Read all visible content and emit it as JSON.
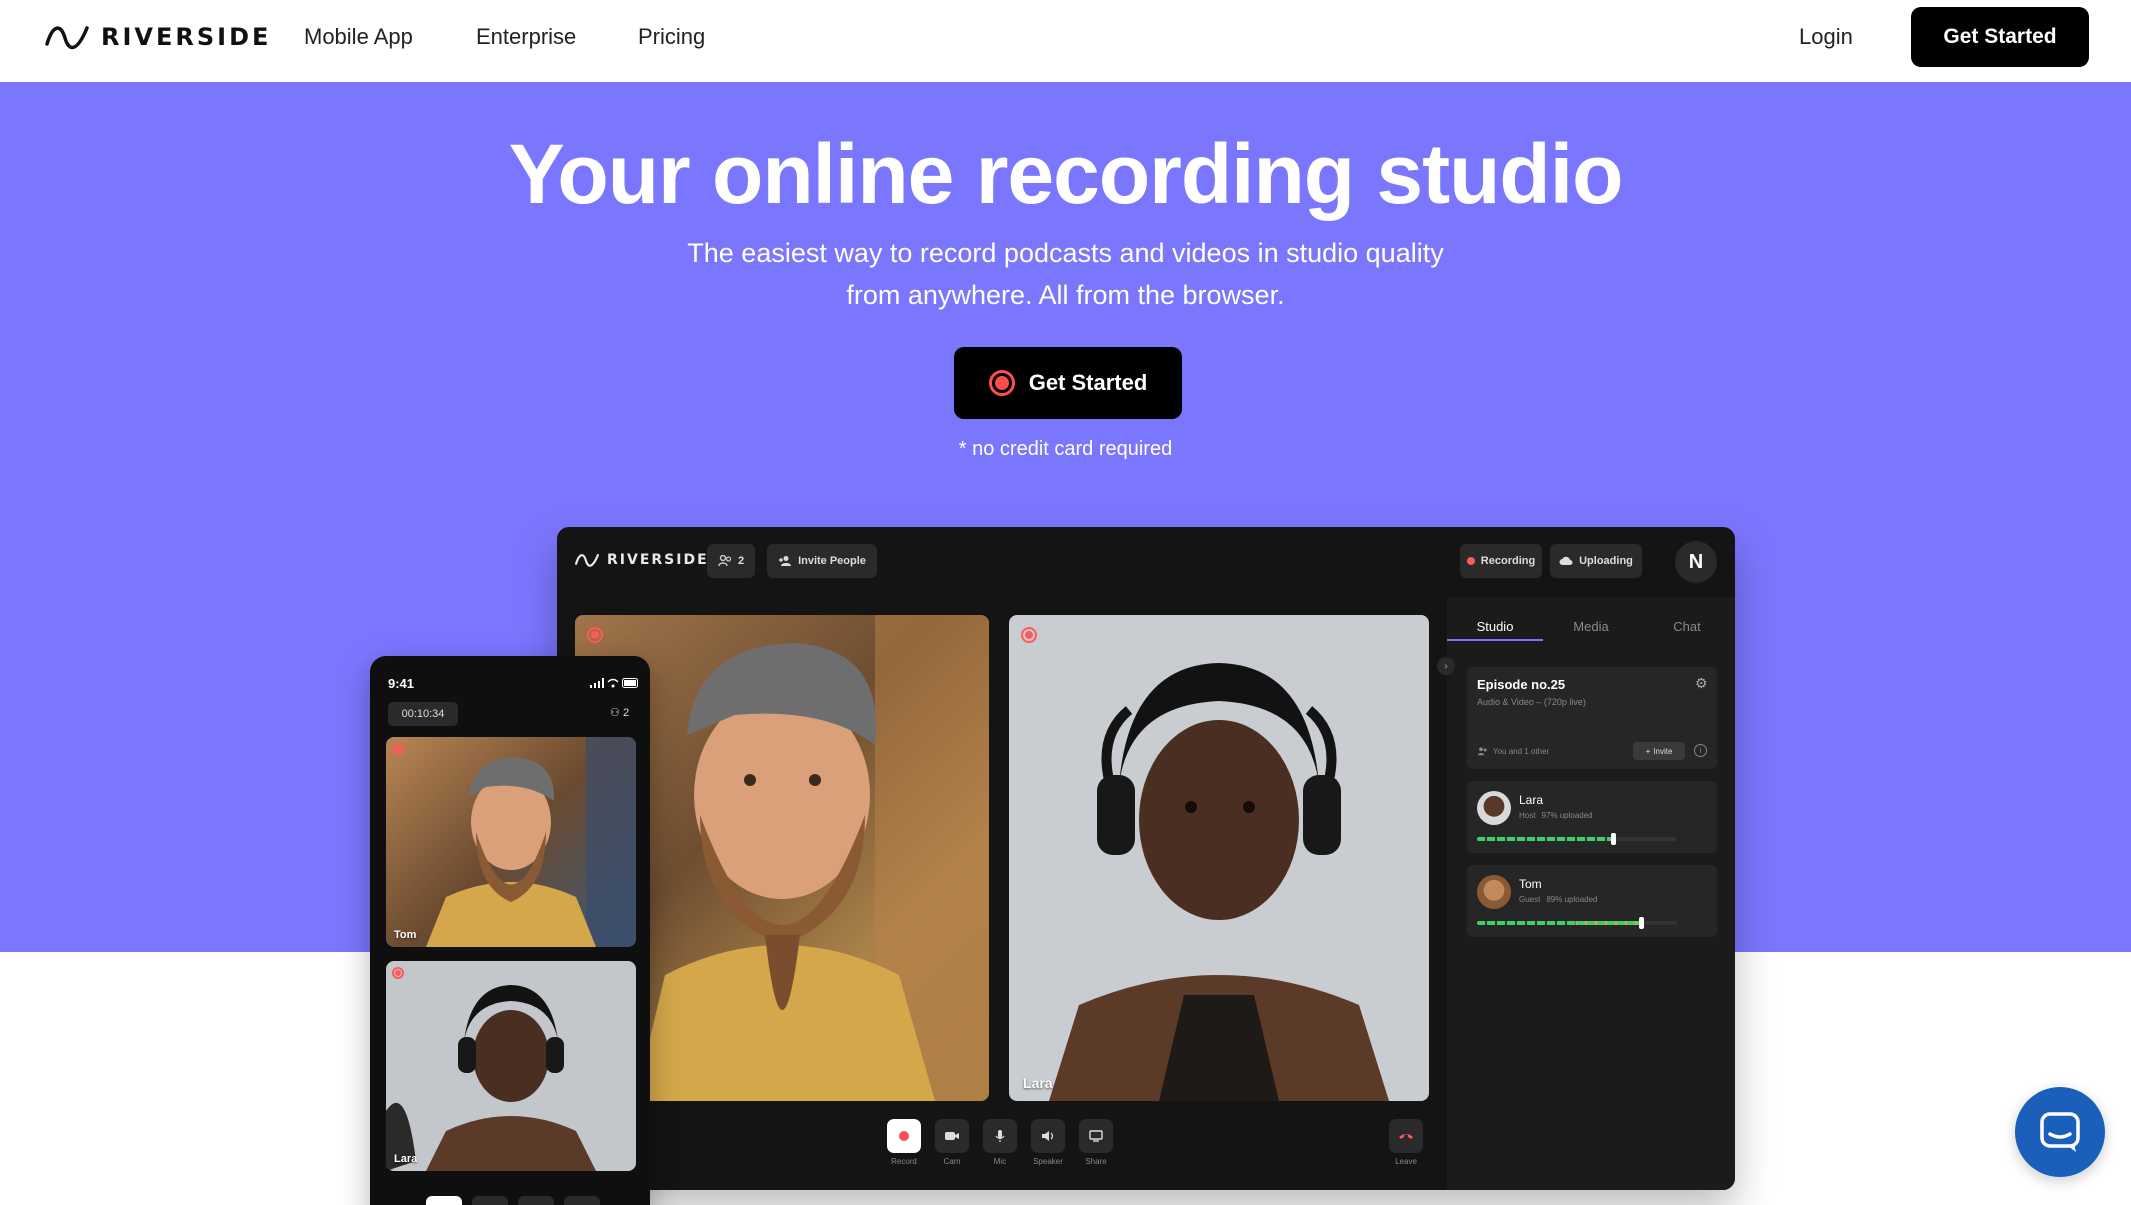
{
  "nav": {
    "brand": "RIVERSIDE",
    "links": [
      "Mobile App",
      "Enterprise",
      "Pricing"
    ],
    "login": "Login",
    "cta": "Get Started"
  },
  "hero": {
    "title": "Your online recording studio",
    "subtitle_line1": "The easiest way to record podcasts and videos in studio quality",
    "subtitle_line2": "from anywhere. All from the browser.",
    "cta": "Get Started",
    "note": "* no credit card required"
  },
  "studio": {
    "brand": "RIVERSIDE",
    "people_count": "2",
    "invite_label": "Invite People",
    "recording_label": "Recording",
    "uploading_label": "Uploading",
    "avatar_letter": "N",
    "tiles": [
      {
        "name": ""
      },
      {
        "name": "Lara"
      }
    ],
    "controls": [
      "Record",
      "Cam",
      "Mic",
      "Speaker",
      "Share"
    ],
    "leave": "Leave",
    "panel": {
      "tabs": [
        "Studio",
        "Media",
        "Chat"
      ],
      "episode_title": "Episode no.25",
      "episode_sub": "Audio & Video – (720p live)",
      "participants_note": "You and 1 other",
      "invite": "Invite",
      "people": [
        {
          "name": "Lara",
          "role": "Host",
          "upload": "97% uploaded",
          "progress": 0.68
        },
        {
          "name": "Tom",
          "role": "Guest",
          "upload": "89% uploaded",
          "progress": 0.82
        }
      ]
    }
  },
  "phone": {
    "time": "9:41",
    "timer": "00:10:34",
    "people_count": "2",
    "tiles": [
      {
        "name": "Tom"
      },
      {
        "name": "Lara"
      }
    ]
  },
  "colors": {
    "hero_bg": "#7b76fe",
    "record_red": "#ff4d4d",
    "chat_fab": "#1a5fbb"
  }
}
